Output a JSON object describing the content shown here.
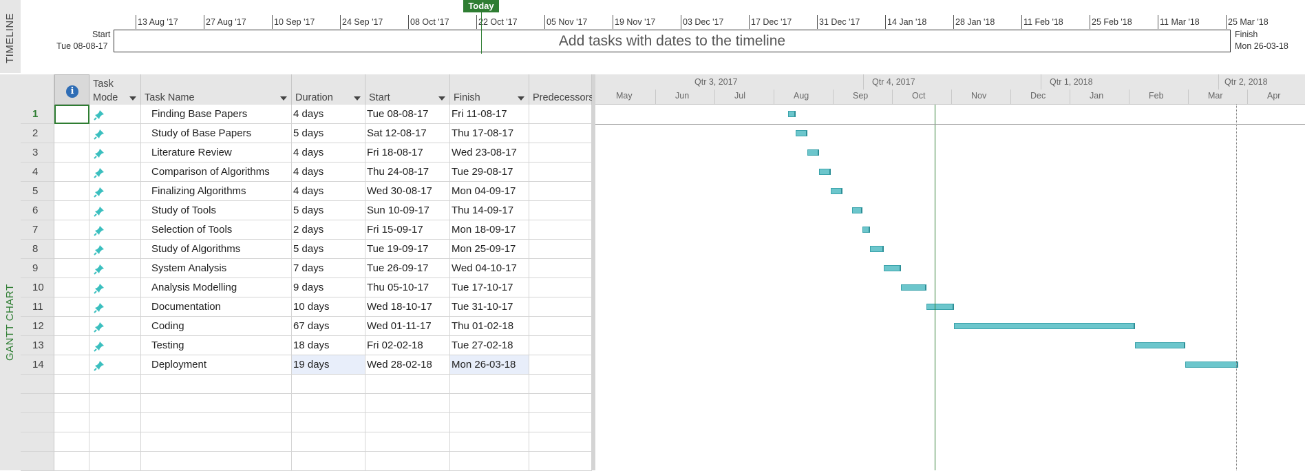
{
  "timeline": {
    "side_label": "TIMELINE",
    "today_label": "Today",
    "ticks": [
      "13 Aug '17",
      "27 Aug '17",
      "10 Sep '17",
      "24 Sep '17",
      "08 Oct '17",
      "22 Oct '17",
      "05 Nov '17",
      "19 Nov '17",
      "03 Dec '17",
      "17 Dec '17",
      "31 Dec '17",
      "14 Jan '18",
      "28 Jan '18",
      "11 Feb '18",
      "25 Feb '18",
      "11 Mar '18",
      "25 Mar '18"
    ],
    "start_label": "Start",
    "start_date": "Tue 08-08-17",
    "finish_label": "Finish",
    "finish_date": "Mon 26-03-18",
    "placeholder": "Add tasks with dates to the timeline"
  },
  "gantt": {
    "side_label": "GANTT CHART",
    "columns": {
      "mode_line1": "Task",
      "mode_line2": "Mode",
      "name": "Task Name",
      "duration": "Duration",
      "start": "Start",
      "finish": "Finish",
      "predecessors": "Predecessors"
    },
    "quarters": [
      "Qtr 3, 2017",
      "Qtr 4, 2017",
      "Qtr 1, 2018",
      "Qtr 2, 2018"
    ],
    "months": [
      "May",
      "Jun",
      "Jul",
      "Aug",
      "Sep",
      "Oct",
      "Nov",
      "Dec",
      "Jan",
      "Feb",
      "Mar",
      "Apr"
    ],
    "tasks": [
      {
        "id": "1",
        "name": "Finding Base Papers",
        "duration": "4 days",
        "start": "Tue 08-08-17",
        "finish": "Fri 11-08-17"
      },
      {
        "id": "2",
        "name": "Study of Base Papers",
        "duration": "5 days",
        "start": "Sat 12-08-17",
        "finish": "Thu 17-08-17"
      },
      {
        "id": "3",
        "name": "Literature Review",
        "duration": "4 days",
        "start": "Fri 18-08-17",
        "finish": "Wed 23-08-17"
      },
      {
        "id": "4",
        "name": "Comparison of Algorithms",
        "duration": "4 days",
        "start": "Thu 24-08-17",
        "finish": "Tue 29-08-17"
      },
      {
        "id": "5",
        "name": "Finalizing Algorithms",
        "duration": "4 days",
        "start": "Wed 30-08-17",
        "finish": "Mon 04-09-17"
      },
      {
        "id": "6",
        "name": "Study of Tools",
        "duration": "5 days",
        "start": "Sun 10-09-17",
        "finish": "Thu 14-09-17"
      },
      {
        "id": "7",
        "name": "Selection of Tools",
        "duration": "2 days",
        "start": "Fri 15-09-17",
        "finish": "Mon 18-09-17"
      },
      {
        "id": "8",
        "name": "Study of Algorithms",
        "duration": "5 days",
        "start": "Tue 19-09-17",
        "finish": "Mon 25-09-17"
      },
      {
        "id": "9",
        "name": "System Analysis",
        "duration": "7 days",
        "start": "Tue 26-09-17",
        "finish": "Wed 04-10-17"
      },
      {
        "id": "10",
        "name": "Analysis Modelling",
        "duration": "9 days",
        "start": "Thu 05-10-17",
        "finish": "Tue 17-10-17"
      },
      {
        "id": "11",
        "name": "Documentation",
        "duration": "10 days",
        "start": "Wed 18-10-17",
        "finish": "Tue 31-10-17"
      },
      {
        "id": "12",
        "name": "Coding",
        "duration": "67 days",
        "start": "Wed 01-11-17",
        "finish": "Thu 01-02-18"
      },
      {
        "id": "13",
        "name": "Testing",
        "duration": "18 days",
        "start": "Fri 02-02-18",
        "finish": "Tue 27-02-18"
      },
      {
        "id": "14",
        "name": "Deployment",
        "duration": "19 days",
        "start": "Wed 28-02-18",
        "finish": "Mon 26-03-18"
      }
    ]
  },
  "colors": {
    "today": "#2e7d32",
    "bar": "#6cc6cc",
    "pin": "#3bbfbf",
    "info": "#2f6db5"
  }
}
